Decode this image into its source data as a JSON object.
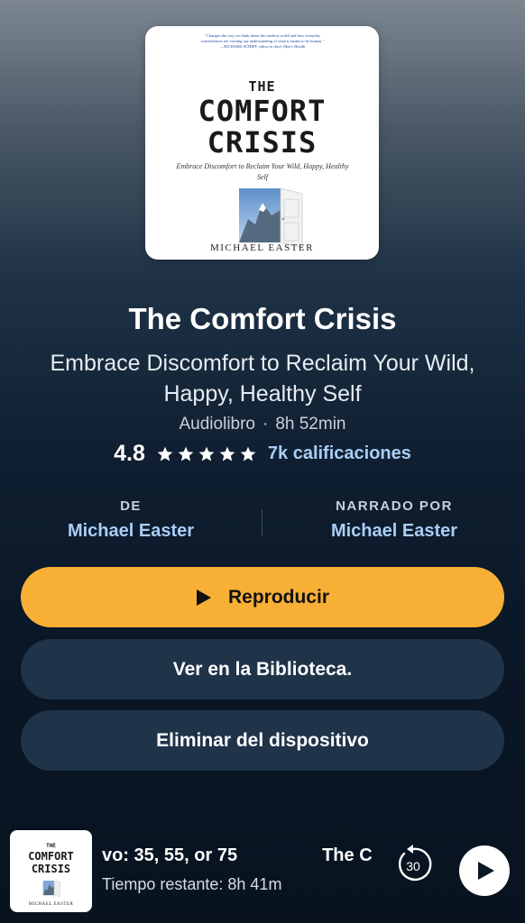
{
  "book": {
    "cover": {
      "blurb": "\"Changes the way we think about the modern world and how everyday conveniences are eroding our understanding of what it means to be human.\" —RICHARD SCHIFF, editor in chief, Men's Health",
      "title_the": "THE",
      "title_line1": "COMFORT",
      "title_line2": "CRISIS",
      "subtitle": "Embrace Discomfort to Reclaim Your Wild, Happy, Healthy Self",
      "author": "MICHAEL EASTER"
    },
    "title": "The Comfort Crisis",
    "subtitle": "Embrace Discomfort to Reclaim Your Wild, Happy, Healthy Self",
    "format": "Audiolibro",
    "separator": "·",
    "duration": "8h 52min",
    "rating": "4.8",
    "stars": 5,
    "ratings_count": "7k calificaciones"
  },
  "credits": {
    "by_label": "DE",
    "by_name": "Michael Easter",
    "narrated_label": "NARRADO POR",
    "narrated_name": "Michael Easter"
  },
  "actions": {
    "play_label": "Reproducir",
    "library_label": "Ver en la Biblioteca.",
    "remove_label": "Eliminar del dispositivo"
  },
  "mini_player": {
    "cover_the": "THE",
    "cover_line1": "COMFORT",
    "cover_line2": "CRISIS",
    "cover_author": "MICHAEL EASTER",
    "scroll_text_1": "vo: 35, 55, or 75",
    "scroll_text_2": "The C",
    "remaining": "Tiempo restante: 8h 41m",
    "rewind_seconds": "30"
  },
  "colors": {
    "accent": "#f7b035",
    "link": "#a9cdf7",
    "button_secondary": "#1f3349"
  },
  "icons": [
    "play-icon",
    "star-icon",
    "rewind-30-icon",
    "play-circle-icon"
  ]
}
